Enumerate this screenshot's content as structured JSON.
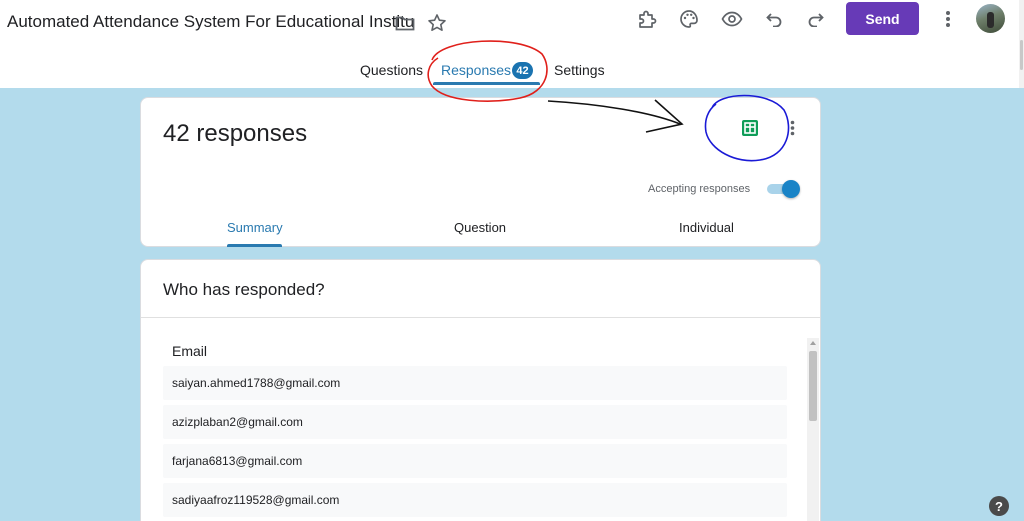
{
  "header": {
    "doc_title": "Automated Attendance System For Educational Institu",
    "send_label": "Send"
  },
  "tabs": {
    "questions": "Questions",
    "responses": "Responses",
    "responses_count": "42",
    "settings": "Settings"
  },
  "summary_card": {
    "title": "42 responses",
    "accepting_label": "Accepting responses",
    "accepting_on": true,
    "sub_tabs": [
      "Summary",
      "Question",
      "Individual"
    ]
  },
  "who_card": {
    "title": "Who has responded?",
    "column_header": "Email",
    "emails": [
      "saiyan.ahmed1788@gmail.com",
      "azizplaban2@gmail.com",
      "farjana6813@gmail.com",
      "sadiyaafroz119528@gmail.com"
    ]
  },
  "help": {
    "label": "?"
  },
  "icons": {
    "header": [
      "folder-icon",
      "star-icon",
      "addon-puzzle-icon",
      "palette-icon",
      "preview-eye-icon",
      "undo-icon",
      "redo-icon",
      "more-vert-icon"
    ],
    "card": [
      "google-sheets-icon",
      "more-vert-icon"
    ]
  },
  "colors": {
    "accent": "#673ab7",
    "tab_active": "#2a7ab0",
    "content_bg": "#b3dbec",
    "sheets_green": "#0f9d58",
    "annotation_red": "#e0201b",
    "annotation_blue": "#1a1ad6"
  }
}
